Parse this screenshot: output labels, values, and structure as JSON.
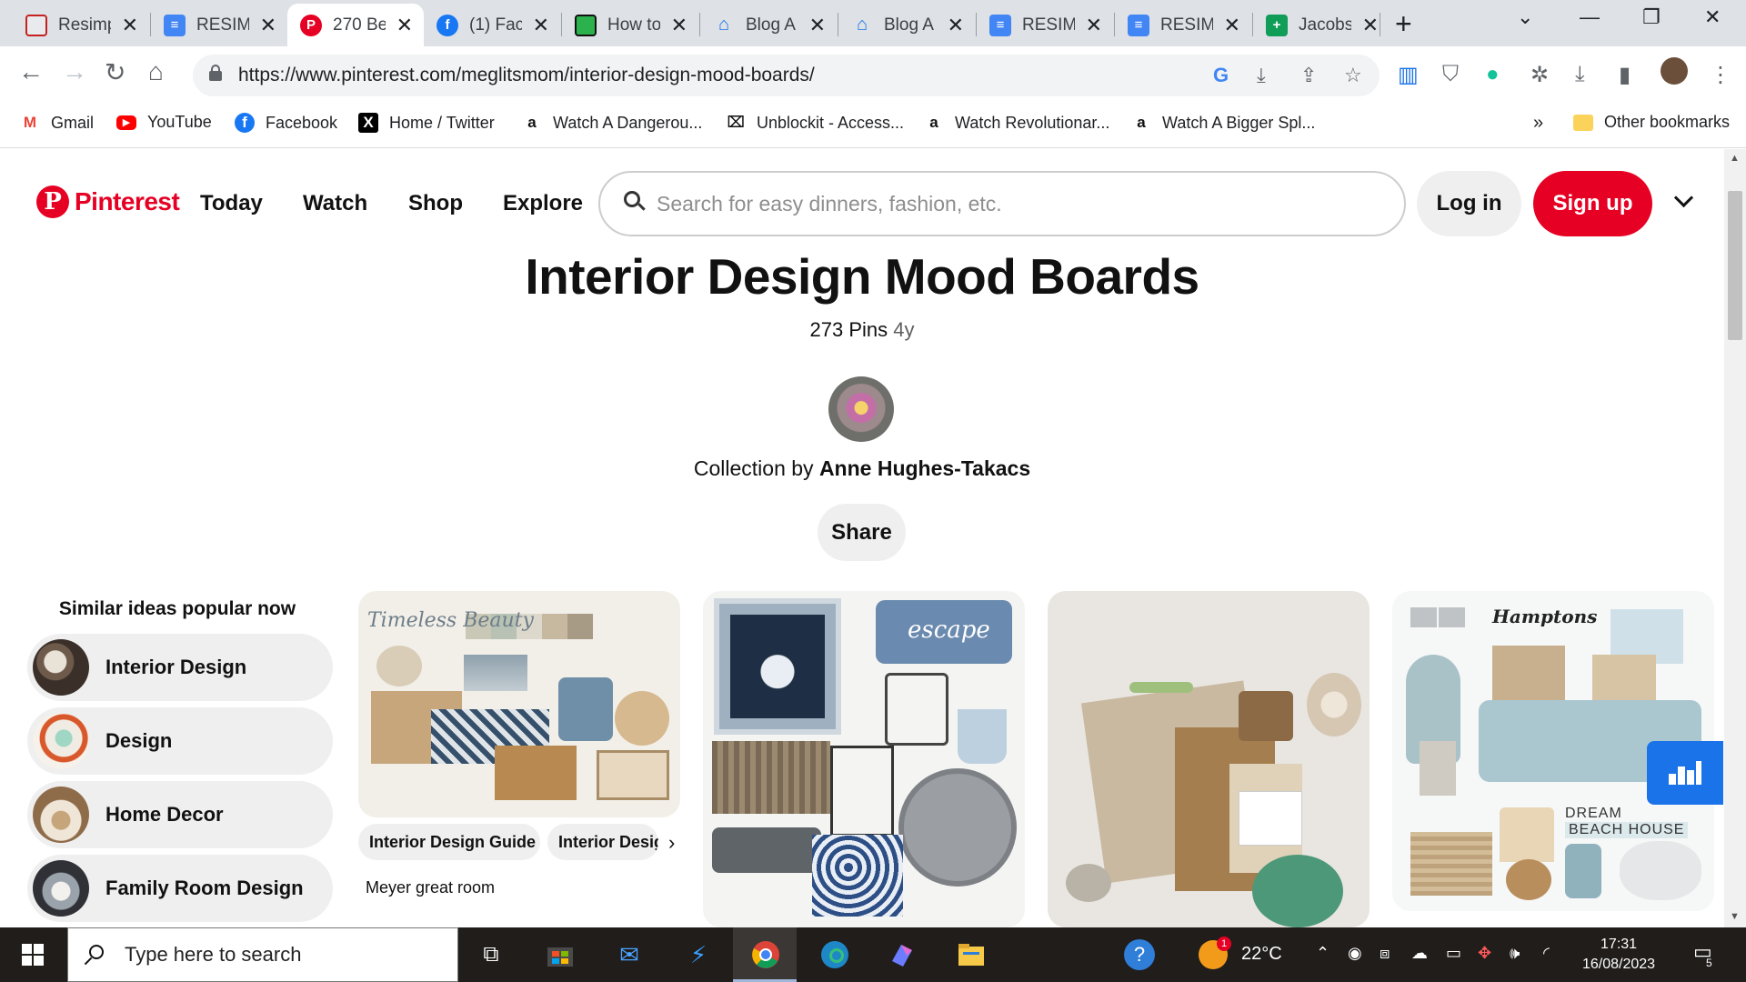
{
  "browser": {
    "tabs": [
      {
        "label": "Resimp",
        "icon": "resimpli-icon",
        "color": "#e8eaed"
      },
      {
        "label": "RESIMP",
        "icon": "google-docs-icon",
        "color": "#4285f4"
      },
      {
        "label": "270 Be",
        "icon": "pinterest-icon",
        "color": "#e60023"
      },
      {
        "label": "(1) Fac",
        "icon": "facebook-icon",
        "color": "#1877f2"
      },
      {
        "label": "How to",
        "icon": "feedly-icon",
        "color": "#2bb24c"
      },
      {
        "label": "Blog A",
        "icon": "house-outline-icon",
        "color": "#ffffff"
      },
      {
        "label": "Blog A",
        "icon": "house-outline-icon",
        "color": "#ffffff"
      },
      {
        "label": "RESIMP",
        "icon": "google-docs-icon",
        "color": "#4285f4"
      },
      {
        "label": "RESIMP",
        "icon": "google-docs-icon",
        "color": "#4285f4"
      },
      {
        "label": "Jacobs",
        "icon": "google-sheets-icon",
        "color": "#0f9d58"
      }
    ],
    "url": "https://www.pinterest.com/meglitsmom/interior-design-mood-boards/",
    "bookmarks": [
      {
        "label": "Gmail",
        "icon": "gmail-icon"
      },
      {
        "label": "YouTube",
        "icon": "youtube-icon"
      },
      {
        "label": "Facebook",
        "icon": "facebook-icon"
      },
      {
        "label": "Home / Twitter",
        "icon": "x-twitter-icon"
      },
      {
        "label": "Watch A Dangerou...",
        "icon": "amazon-icon"
      },
      {
        "label": "Unblockit - Access...",
        "icon": "briefcase-icon"
      },
      {
        "label": "Watch Revolutionar...",
        "icon": "amazon-icon"
      },
      {
        "label": "Watch A Bigger Spl...",
        "icon": "amazon-icon"
      }
    ],
    "bookmarks_overflow": "»",
    "other_bookmarks": "Other bookmarks"
  },
  "pinterest": {
    "logo": "Pinterest",
    "nav": [
      "Today",
      "Watch",
      "Shop",
      "Explore"
    ],
    "search_placeholder": "Search for easy dinners, fashion, etc.",
    "login": "Log in",
    "signup": "Sign up"
  },
  "board": {
    "title": "Interior Design Mood Boards",
    "pins": "273 Pins",
    "age": "4y",
    "collection_prefix": "Collection by",
    "owner": "Anne Hughes-Takacs",
    "share": "Share"
  },
  "similar": {
    "title": "Similar ideas popular now",
    "items": [
      "Interior Design",
      "Design",
      "Home Decor",
      "Family Room Design"
    ]
  },
  "pins": {
    "chips": [
      "Interior Design Guide",
      "Interior Design"
    ],
    "caption": "Meyer great room",
    "overlay_timeless": "Timeless Beauty",
    "overlay_escape": "escape",
    "overlay_hamptons": "Hamptons",
    "overlay_dream": "DREAM",
    "overlay_beach": "BEACH HOUSE"
  },
  "taskbar": {
    "search": "Type here to search",
    "weather": "22°C",
    "time": "17:31",
    "date": "16/08/2023",
    "notifications": "5",
    "weather_badge": "1"
  }
}
